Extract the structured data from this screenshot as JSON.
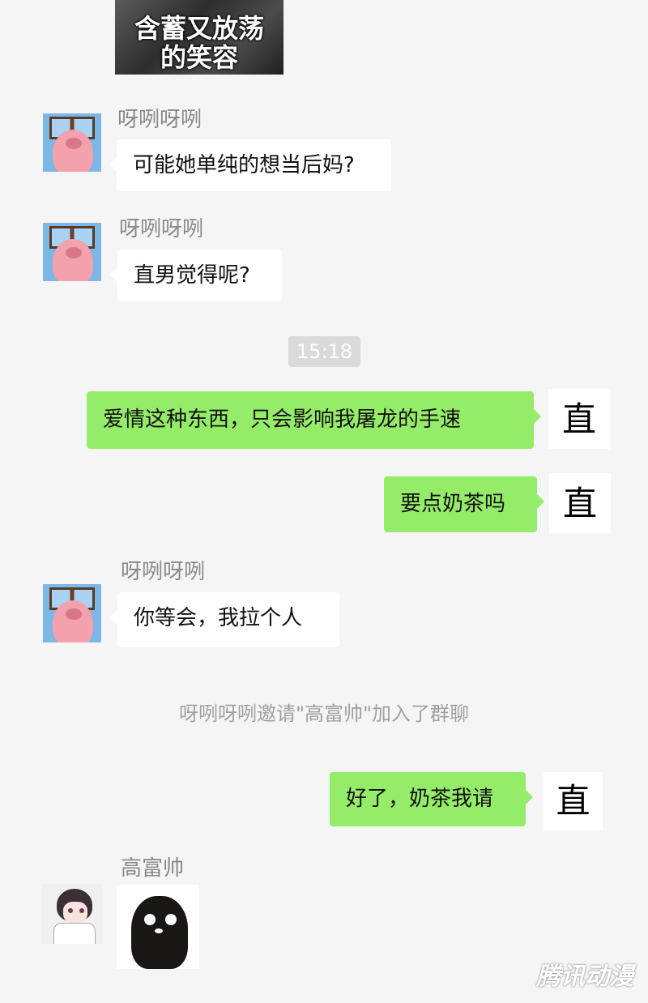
{
  "top_image": {
    "caption_line1": "含蓄又放荡",
    "caption_line2": "的笑容"
  },
  "messages": [
    {
      "sender": "呀咧呀咧",
      "text": "可能她单纯的想当后妈?"
    },
    {
      "sender": "呀咧呀咧",
      "text": "直男觉得呢?"
    },
    {
      "time": "15:18"
    },
    {
      "self_text": "爱情这种东西，只会影响我屠龙的手速",
      "avatar_char": "直"
    },
    {
      "self_text": "要点奶茶吗",
      "avatar_char": "直"
    },
    {
      "sender": "呀咧呀咧",
      "text": "你等会，我拉个人"
    },
    {
      "system": "呀咧呀咧邀请\"高富帅\"加入了群聊"
    },
    {
      "self_text": "好了，奶茶我请",
      "avatar_char": "直"
    },
    {
      "sender": "高富帅",
      "sticker": "penguin-sticker"
    }
  ],
  "watermark": "腾讯动漫",
  "colors": {
    "background": "#f5f5f5",
    "self_bubble": "#95ec69",
    "other_bubble": "#ffffff",
    "time_chip": "#dadada"
  }
}
